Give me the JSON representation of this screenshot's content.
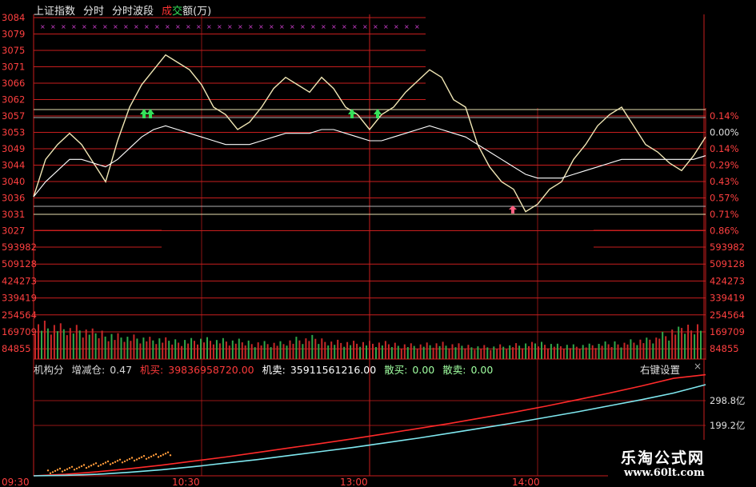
{
  "header": {
    "index_name": "上证指数",
    "tab_timeshare": "分时",
    "tab_wave": "分时波段",
    "vol_label_a": "成",
    "vol_label_b": "交",
    "vol_label_c": "额(万)"
  },
  "indicator_bar": {
    "name": "机构分",
    "position_label": "增减仓:",
    "position_value": "0.47",
    "inst_buy_label": "机买:",
    "inst_buy_value": "39836958720.00",
    "inst_sell_label": "机卖:",
    "inst_sell_value": "35911561216.00",
    "retail_buy_label": "散买:",
    "retail_buy_value": "0.00",
    "retail_sell_label": "散卖:",
    "retail_sell_value": "0.00",
    "right_click": "右键设置",
    "close": "×"
  },
  "watermark": {
    "title": "乐淘公式网",
    "url": "www.60lt.com"
  },
  "colors": {
    "background": "#000000",
    "grid_red": "#c81e1e",
    "price_line": "#f0e6b4",
    "avg_line": "#ffffff",
    "volume_red": "#c82828",
    "volume_green": "#2fa84a",
    "inst_buy_line": "#ff2a2a",
    "inst_sell_line": "#7fe8f0",
    "marker_magenta": "#d040d0"
  },
  "chart_data": [
    {
      "type": "line",
      "title": "",
      "price_axis_left": [
        "3084",
        "3079",
        "3075",
        "3071",
        "3066",
        "3062",
        "3057",
        "3053",
        "3049",
        "3044",
        "3040",
        "3036",
        "3031",
        "3027"
      ],
      "pct_axis_right": [
        "0.14%",
        "0.00%",
        "0.14%",
        "0.29%",
        "0.43%",
        "0.57%",
        "0.71%",
        "0.86%"
      ],
      "time_labels": [
        "09:30",
        "10:30",
        "13:00",
        "14:00"
      ],
      "ylim": [
        3027,
        3084
      ],
      "prev_close": 3053,
      "series": [
        {
          "role": "price",
          "values": [
            3036,
            3046,
            3050,
            3053,
            3050,
            3045,
            3040,
            3051,
            3060,
            3066,
            3070,
            3074,
            3072,
            3070,
            3066,
            3060,
            3058,
            3054,
            3056,
            3060,
            3065,
            3068,
            3066,
            3064,
            3068,
            3065,
            3060,
            3058,
            3054,
            3058,
            3060,
            3064,
            3067,
            3070,
            3068,
            3062,
            3060,
            3050,
            3044,
            3040,
            3038,
            3032,
            3034,
            3038,
            3040,
            3046,
            3050,
            3055,
            3058,
            3060,
            3055,
            3050,
            3048,
            3045,
            3043,
            3047,
            3052
          ]
        },
        {
          "role": "average",
          "values": [
            3036,
            3040,
            3043,
            3046,
            3046,
            3045,
            3044,
            3046,
            3049,
            3052,
            3054,
            3055,
            3054,
            3053,
            3052,
            3051,
            3050,
            3050,
            3050,
            3051,
            3052,
            3053,
            3053,
            3053,
            3054,
            3054,
            3053,
            3052,
            3051,
            3051,
            3052,
            3053,
            3054,
            3055,
            3054,
            3053,
            3052,
            3050,
            3048,
            3046,
            3044,
            3042,
            3041,
            3041,
            3041,
            3042,
            3043,
            3044,
            3045,
            3046,
            3046,
            3046,
            3046,
            3046,
            3046,
            3046,
            3047
          ]
        }
      ]
    },
    {
      "type": "bar",
      "title": "",
      "axis_left": [
        "593982",
        "509128",
        "424273",
        "339419",
        "254564",
        "169709",
        "84855"
      ],
      "axis_right": [
        "593982",
        "509128",
        "424273",
        "339419",
        "254564",
        "169709",
        "84855"
      ],
      "ylim": [
        0,
        593982
      ],
      "values": [
        175000,
        168000,
        160000,
        150000,
        140000,
        132000,
        126000,
        118000,
        110000,
        104000,
        98000,
        94000,
        92000,
        96000,
        100000,
        98000,
        92000,
        88000,
        86000,
        84000,
        82000,
        80000,
        90000,
        98000,
        104000,
        96000,
        88000,
        84000,
        82000,
        80000,
        78000,
        76000,
        74000,
        72000,
        74000,
        76000,
        70000,
        68000,
        66000,
        64000,
        62000,
        66000,
        70000,
        74000,
        80000,
        76000,
        70000,
        66000,
        68000,
        72000,
        76000,
        82000,
        90000,
        96000,
        104000,
        120000,
        140000,
        160000,
        175000
      ]
    },
    {
      "type": "line",
      "title": "",
      "axis_right": [
        "298.8亿",
        "199.2亿"
      ],
      "series": [
        {
          "name": "机买",
          "values": [
            0,
            6,
            16,
            28,
            42,
            58,
            74,
            92,
            110,
            128,
            146,
            166,
            186,
            206,
            228,
            250,
            274,
            300,
            326,
            354,
            384,
            398
          ]
        },
        {
          "name": "机卖",
          "values": [
            0,
            2,
            6,
            14,
            24,
            36,
            50,
            64,
            80,
            96,
            112,
            130,
            148,
            168,
            188,
            208,
            230,
            252,
            276,
            300,
            326,
            359
          ]
        }
      ]
    }
  ]
}
